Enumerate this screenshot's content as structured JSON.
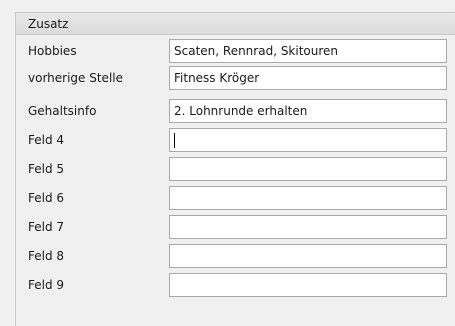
{
  "section": {
    "title": "Zusatz"
  },
  "rows": [
    {
      "label": "Hobbies",
      "value": "Scaten, Rennrad, Skitouren"
    },
    {
      "label": "vorherige Stelle",
      "value": "Fitness Kröger"
    },
    {
      "label": "Gehaltsinfo",
      "value": "2. Lohnrunde erhalten"
    },
    {
      "label": "Feld 4",
      "value": ""
    },
    {
      "label": "Feld 5",
      "value": ""
    },
    {
      "label": "Feld 6",
      "value": ""
    },
    {
      "label": "Feld 7",
      "value": ""
    },
    {
      "label": "Feld 8",
      "value": ""
    },
    {
      "label": "Feld 9",
      "value": ""
    }
  ]
}
